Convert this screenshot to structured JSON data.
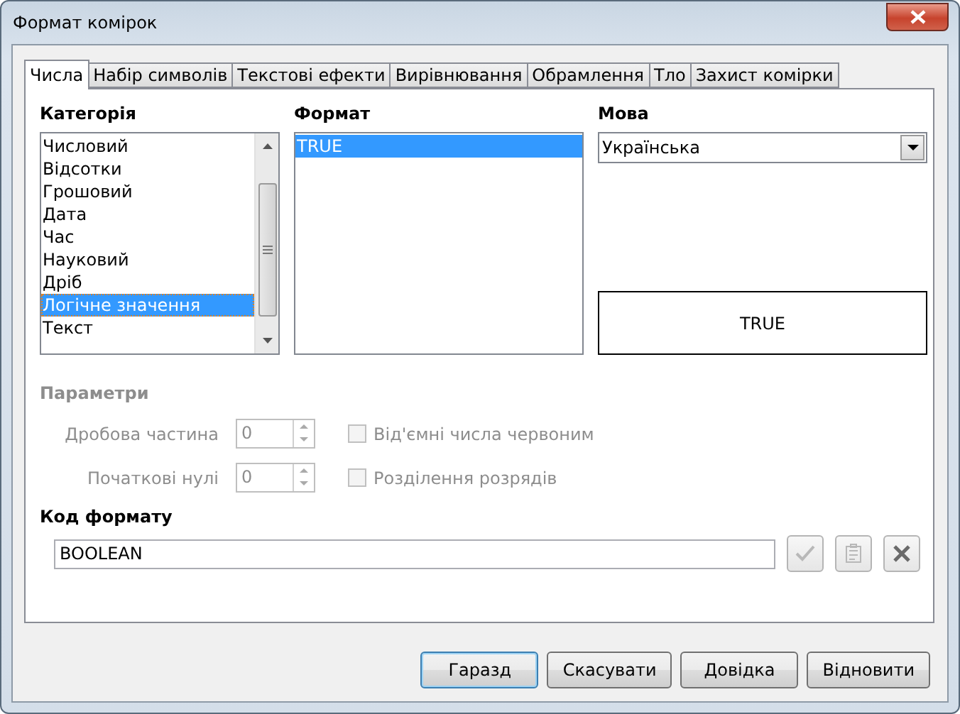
{
  "window": {
    "title": "Формат комірок"
  },
  "tabs": [
    {
      "label": "Числа",
      "selected": true
    },
    {
      "label": "Набір символів",
      "selected": false
    },
    {
      "label": "Текстові ефекти",
      "selected": false
    },
    {
      "label": "Вирівнювання",
      "selected": false
    },
    {
      "label": "Обрамлення",
      "selected": false
    },
    {
      "label": "Тло",
      "selected": false
    },
    {
      "label": "Захист комірки",
      "selected": false
    }
  ],
  "category": {
    "label": "Категорія",
    "items": [
      {
        "label": "Числовий",
        "selected": false
      },
      {
        "label": "Відсотки",
        "selected": false
      },
      {
        "label": "Грошовий",
        "selected": false
      },
      {
        "label": "Дата",
        "selected": false
      },
      {
        "label": "Час",
        "selected": false
      },
      {
        "label": "Науковий",
        "selected": false
      },
      {
        "label": "Дріб",
        "selected": false
      },
      {
        "label": "Логічне значення",
        "selected": true
      },
      {
        "label": "Текст",
        "selected": false
      }
    ]
  },
  "format": {
    "label": "Формат",
    "items": [
      {
        "label": "TRUE",
        "selected": true
      }
    ]
  },
  "language": {
    "label": "Мова",
    "value": "Українська"
  },
  "preview": "TRUE",
  "options": {
    "heading": "Параметри",
    "disabled": true,
    "fields": [
      {
        "label": "Дробова частина",
        "value": "0"
      },
      {
        "label": "Початкові нулі",
        "value": "0"
      }
    ],
    "checkboxes": [
      {
        "label": "Від'ємні числа червоним",
        "checked": false
      },
      {
        "label": "Розділення розрядів",
        "checked": false
      }
    ]
  },
  "format_code": {
    "label": "Код формату",
    "value": "BOOLEAN",
    "actions": [
      {
        "kind": "accept",
        "disabled": true
      },
      {
        "kind": "comment",
        "disabled": true
      },
      {
        "kind": "delete",
        "disabled": false
      }
    ]
  },
  "buttons": [
    {
      "label": "Гаразд",
      "default": true
    },
    {
      "label": "Скасувати",
      "default": false
    },
    {
      "label": "Довідка",
      "default": false
    },
    {
      "label": "Відновити",
      "default": false
    }
  ]
}
